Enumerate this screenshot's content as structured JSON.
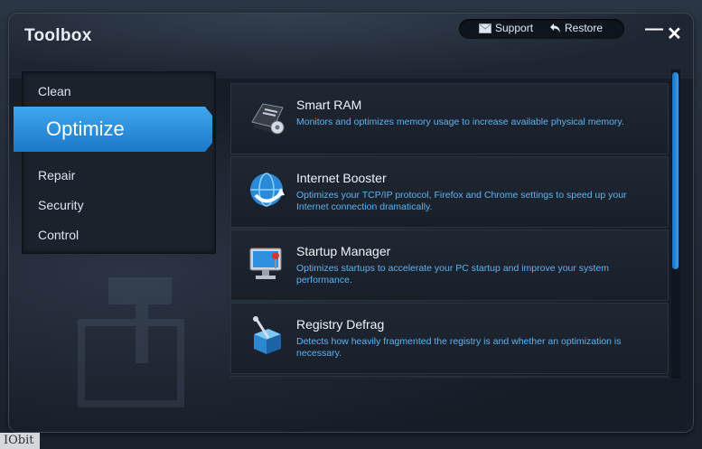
{
  "window": {
    "title": "Toolbox",
    "support_label": "Support",
    "restore_label": "Restore",
    "minimize_glyph": "—",
    "close_glyph": "✕"
  },
  "nav": {
    "items": [
      {
        "label": "Clean"
      },
      {
        "label": "Optimize",
        "active": true
      },
      {
        "label": "Repair"
      },
      {
        "label": "Security"
      },
      {
        "label": "Control"
      }
    ]
  },
  "tools": [
    {
      "title": "Smart RAM",
      "description": "Monitors and optimizes memory usage to increase available physical memory.",
      "icon": "ram-chip-icon"
    },
    {
      "title": "Internet Booster",
      "description": "Optimizes your TCP/IP protocol, Firefox and Chrome settings to speed up your Internet connection dramatically.",
      "icon": "globe-icon"
    },
    {
      "title": "Startup Manager",
      "description": "Optimizes startups to accelerate your PC startup and improve your system performance.",
      "icon": "monitor-startup-icon"
    },
    {
      "title": "Registry Defrag",
      "description": "Detects how heavily fragmented the registry is and whether an optimization is necessary.",
      "icon": "registry-cube-icon"
    }
  ],
  "brand": {
    "label": "IObit"
  },
  "colors": {
    "accent": "#2b8fe0",
    "description_text": "#5fb3f0"
  }
}
